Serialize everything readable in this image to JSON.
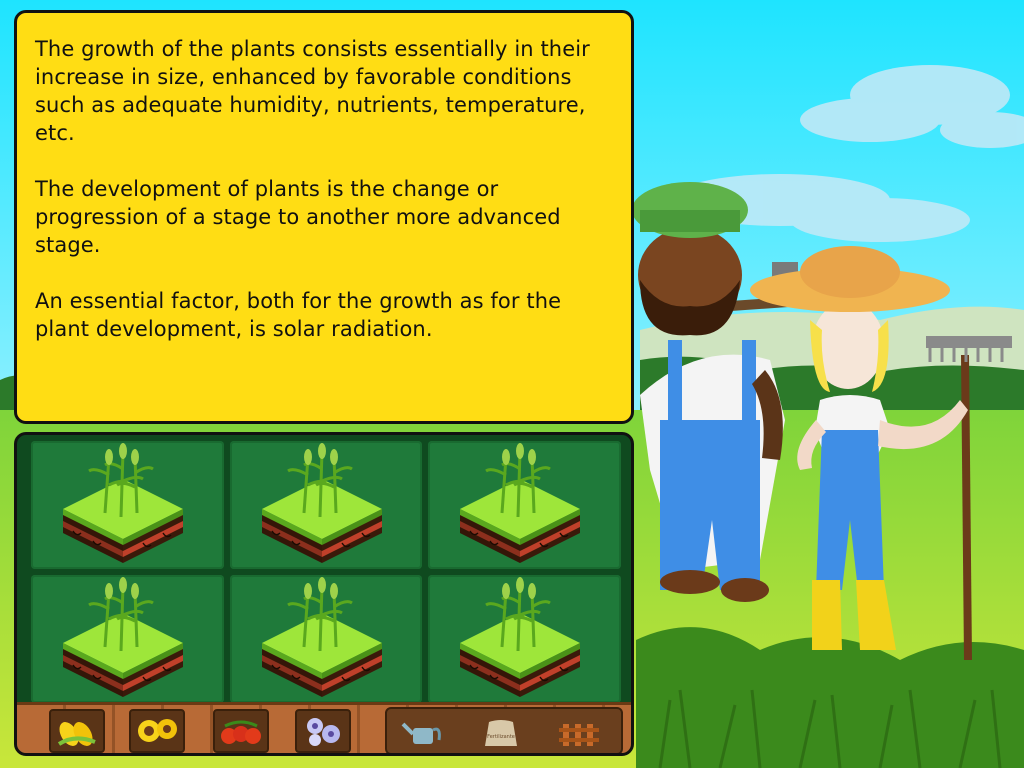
{
  "info": {
    "paragraphs": [
      "The growth of the plants consists essentially in their increase in size, enhanced by favorable conditions such as adequate humidity, nutrients, temperature, etc.",
      "The development of plants is the change or progression of a stage to another more advanced stage.",
      "An essential factor, both for the growth as for the plant development, is solar radiation."
    ]
  },
  "plots": [
    {
      "crop": "corn",
      "stage": "grown"
    },
    {
      "crop": "corn",
      "stage": "grown"
    },
    {
      "crop": "corn",
      "stage": "grown"
    },
    {
      "crop": "corn",
      "stage": "grown"
    },
    {
      "crop": "corn",
      "stage": "grown"
    },
    {
      "crop": "corn",
      "stage": "grown"
    }
  ],
  "toolbar": {
    "seeds": [
      "corn-icon",
      "sunflower-icon",
      "tomato-icon",
      "flower-icon"
    ],
    "tools": [
      "watering-can-icon",
      "fertilizer-sack-icon",
      "fence-icon"
    ],
    "sack_label": "Fertilizante"
  },
  "colors": {
    "panel_yellow": "#ffdd14",
    "farm_green": "#0f4a1f",
    "plot_green": "#1f7a3a",
    "sky": "#2fe6ff",
    "wood": "#b86a36"
  }
}
